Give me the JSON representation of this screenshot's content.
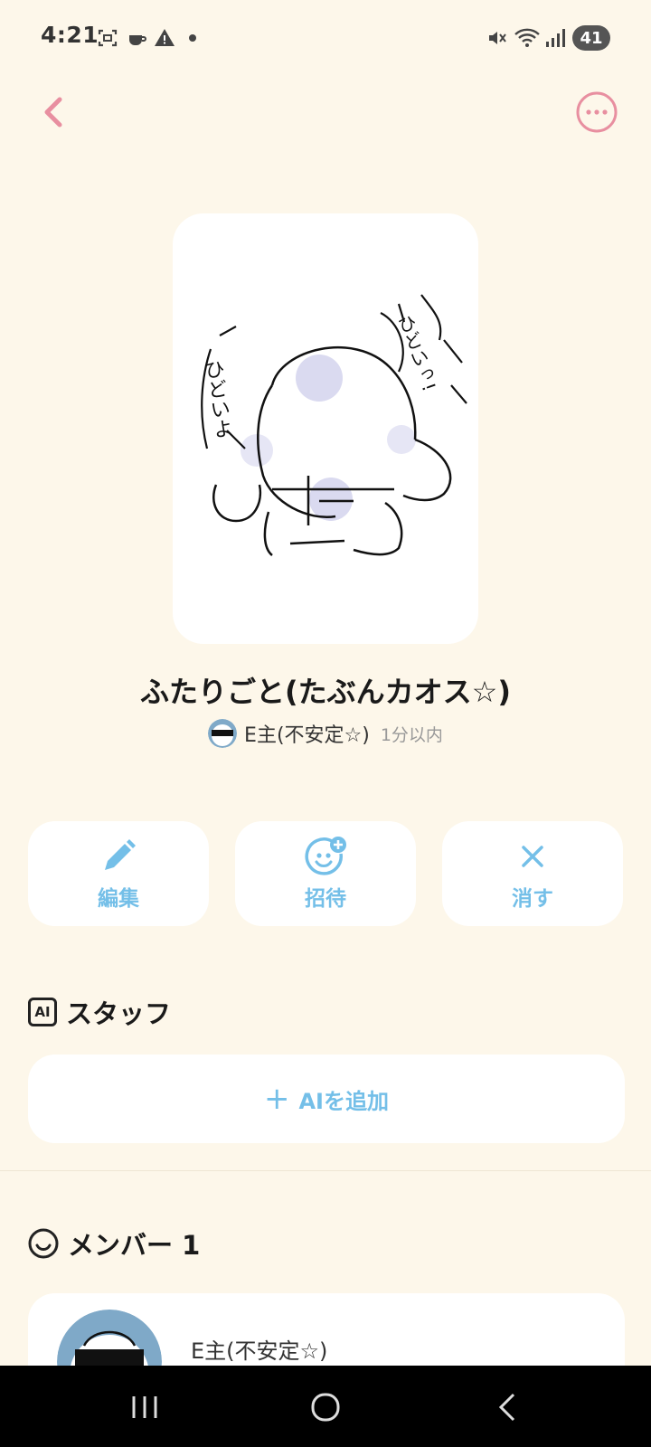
{
  "status_bar": {
    "time": "4:21",
    "battery": "41",
    "icons": [
      "screenshot-icon",
      "cup-icon",
      "warning-icon",
      "dot-icon",
      "mute-icon",
      "wifi-icon",
      "signal-icon"
    ]
  },
  "header": {
    "back_icon": "chevron-left-icon",
    "more_icon": "more-horizontal-icon",
    "accent_color": "#E88FA0"
  },
  "room": {
    "title": "ふたりごと(たぶんカオス☆)",
    "owner_name": "E主(不安定☆)",
    "updated": "1分以内",
    "cover_text_left": "ひどいよ",
    "cover_text_right": "ひどいっ!"
  },
  "actions": [
    {
      "label": "編集",
      "icon": "pencil-icon"
    },
    {
      "label": "招待",
      "icon": "smile-plus-icon"
    },
    {
      "label": "消す",
      "icon": "close-icon"
    }
  ],
  "staff_section": {
    "badge": "AI",
    "title": "スタッフ",
    "add_label": "AIを追加"
  },
  "members_section": {
    "title": "メンバー 1",
    "members": [
      {
        "name": "E主(不安定☆)"
      }
    ]
  },
  "colors": {
    "background": "#FDF7EA",
    "action_blue": "#74BFE8",
    "accent_pink": "#E88FA0"
  }
}
